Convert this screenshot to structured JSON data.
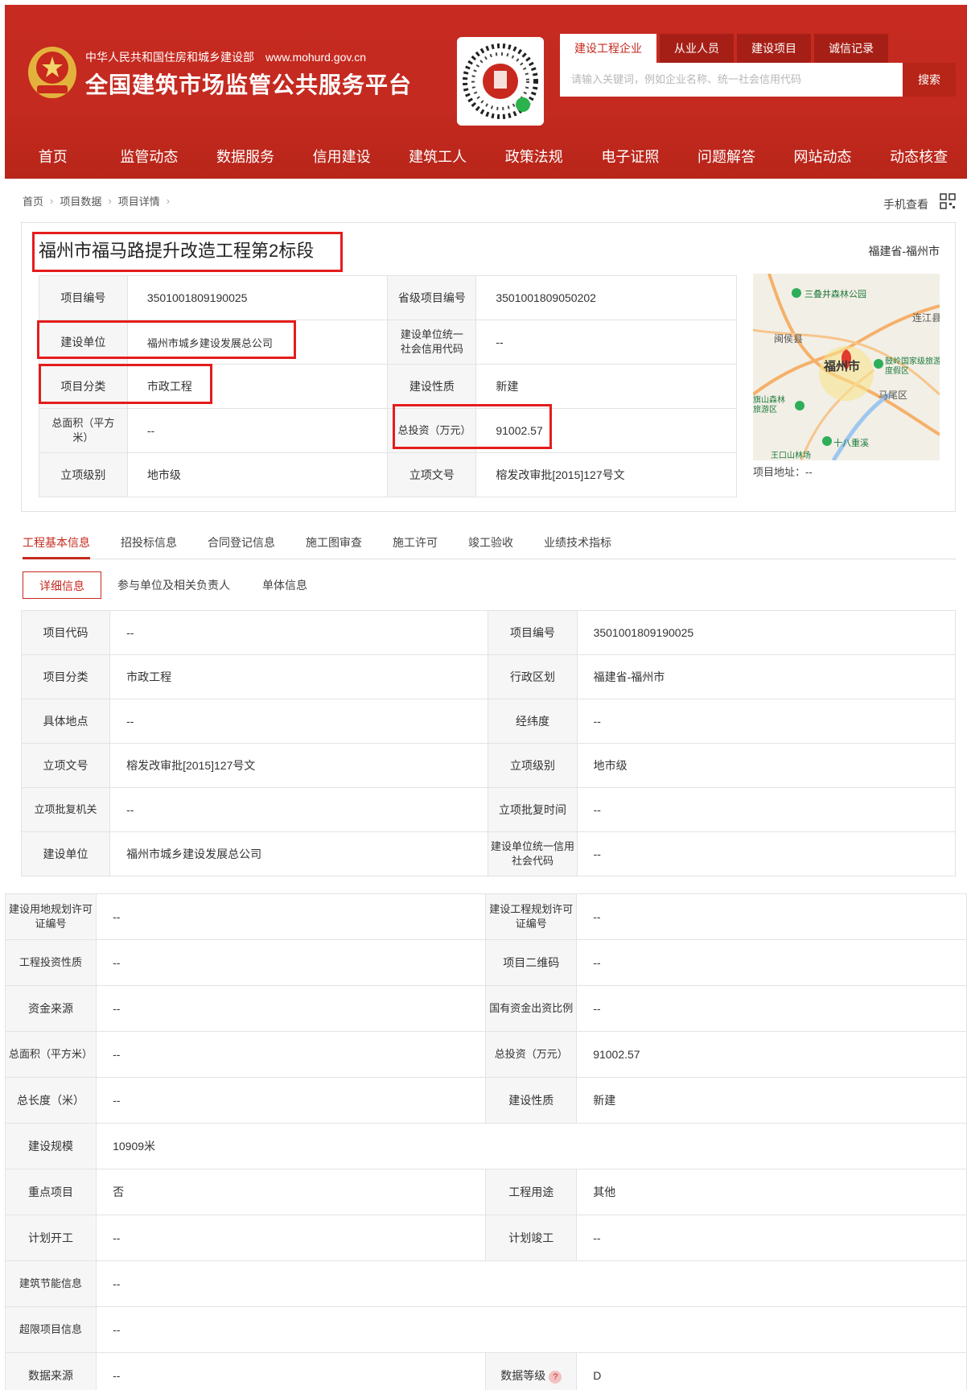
{
  "header": {
    "org_small": "中华人民共和国住房和城乡建设部",
    "org_url": "www.mohurd.gov.cn",
    "platform_name": "全国建筑市场监管公共服务平台",
    "search_tabs": [
      "建设工程企业",
      "从业人员",
      "建设项目",
      "诚信记录"
    ],
    "search_placeholder": "请输入关键词，例如企业名称、统一社会信用代码",
    "search_button": "搜索",
    "nav": [
      "首页",
      "监管动态",
      "数据服务",
      "信用建设",
      "建筑工人",
      "政策法规",
      "电子证照",
      "问题解答",
      "网站动态",
      "动态核查"
    ]
  },
  "breadcrumb": [
    "首页",
    "项目数据",
    "项目详情"
  ],
  "mobile_view": "手机查看",
  "project": {
    "title": "福州市福马路提升改造工程第2标段",
    "region": "福建省-福州市",
    "rows": [
      {
        "l1": "项目编号",
        "v1": "3501001809190025",
        "l2": "省级项目编号",
        "v2": "3501001809050202"
      },
      {
        "l1": "建设单位",
        "v1": "福州市城乡建设发展总公司",
        "l2": "建设单位统一社会信用代码",
        "v2": "--"
      },
      {
        "l1": "项目分类",
        "v1": "市政工程",
        "l2": "建设性质",
        "v2": "新建"
      },
      {
        "l1": "总面积（平方米）",
        "v1": "--",
        "l2": "总投资（万元）",
        "v2": "91002.57"
      },
      {
        "l1": "立项级别",
        "v1": "地市级",
        "l2": "立项文号",
        "v2": "榕发改审批[2015]127号文"
      }
    ],
    "map_labels": [
      "三叠井森林公园",
      "连江县",
      "闽侯县",
      "福州市",
      "鼓岭国家级旅游度假区",
      "马尾区",
      "旗山森林旅游区",
      "十八重溪",
      "王口山林场"
    ],
    "map_address_label": "项目地址：",
    "map_address_value": "--"
  },
  "tabs": [
    "工程基本信息",
    "招投标信息",
    "合同登记信息",
    "施工图审查",
    "施工许可",
    "竣工验收",
    "业绩技术指标"
  ],
  "subtabs": [
    "详细信息",
    "参与单位及相关负责人",
    "单体信息"
  ],
  "detail": [
    {
      "l1": "项目代码",
      "v1": "--",
      "l2": "项目编号",
      "v2": "3501001809190025"
    },
    {
      "l1": "项目分类",
      "v1": "市政工程",
      "l2": "行政区划",
      "v2": "福建省-福州市"
    },
    {
      "l1": "具体地点",
      "v1": "--",
      "l2": "经纬度",
      "v2": "--"
    },
    {
      "l1": "立项文号",
      "v1": "榕发改审批[2015]127号文",
      "l2": "立项级别",
      "v2": "地市级"
    },
    {
      "l1": "立项批复机关",
      "v1": "--",
      "l2": "立项批复时间",
      "v2": "--"
    },
    {
      "l1": "建设单位",
      "v1": "福州市城乡建设发展总公司",
      "l2": "建设单位统一信用社会代码",
      "v2": "--"
    }
  ],
  "detail2": [
    {
      "l1": "建设用地规划许可证编号",
      "v1": "--",
      "l2": "建设工程规划许可证编号",
      "v2": "--"
    },
    {
      "l1": "工程投资性质",
      "v1": "--",
      "l2": "项目二维码",
      "v2": "--"
    },
    {
      "l1": "资金来源",
      "v1": "--",
      "l2": "国有资金出资比例",
      "v2": "--"
    },
    {
      "l1": "总面积（平方米）",
      "v1": "--",
      "l2": "总投资（万元）",
      "v2": "91002.57"
    },
    {
      "l1": "总长度（米）",
      "v1": "--",
      "l2": "建设性质",
      "v2": "新建"
    },
    {
      "l1": "建设规模",
      "v1": "10909米"
    },
    {
      "l1": "重点项目",
      "v1": "否",
      "l2": "工程用途",
      "v2": "其他"
    },
    {
      "l1": "计划开工",
      "v1": "--",
      "l2": "计划竣工",
      "v2": "--"
    },
    {
      "l1": "建筑节能信息",
      "v1": "--"
    },
    {
      "l1": "超限项目信息",
      "v1": "--"
    },
    {
      "l1": "数据来源",
      "v1": "--",
      "l2": "数据等级",
      "v2": "D"
    }
  ],
  "colors": {
    "brand_red": "#c62a20",
    "highlight": "#e51c1c"
  }
}
